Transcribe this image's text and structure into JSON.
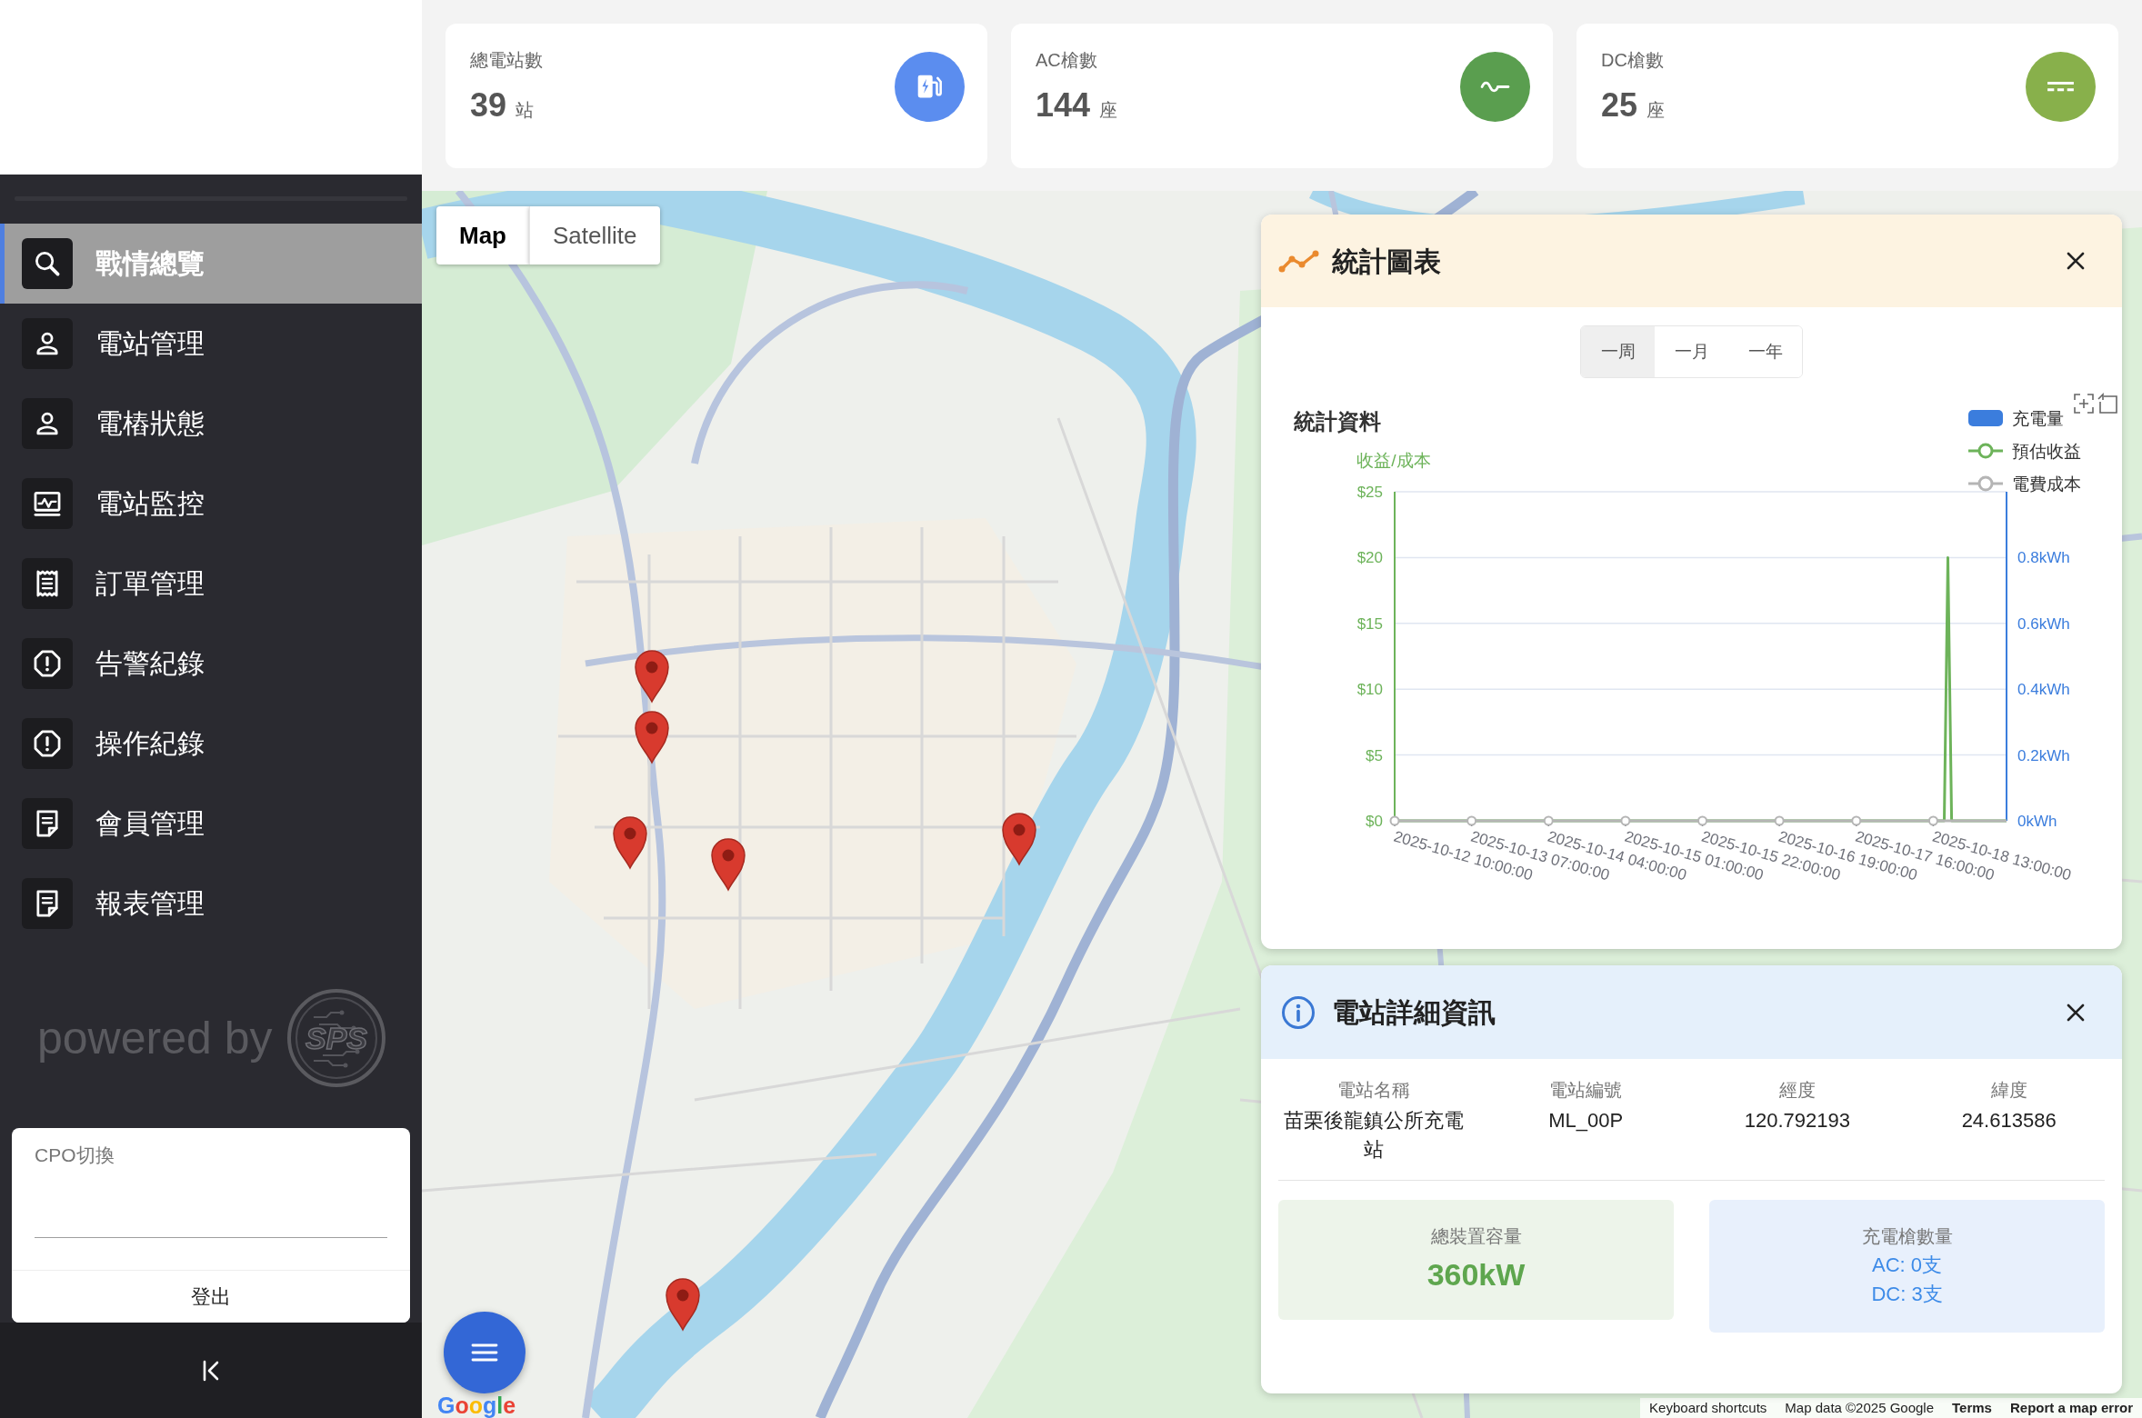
{
  "sidebar": {
    "menu": [
      {
        "label": "戰情總覽",
        "kind": "search",
        "selected": true
      },
      {
        "label": "電站管理",
        "kind": "person",
        "selected": false
      },
      {
        "label": "電樁狀態",
        "kind": "person",
        "selected": false
      },
      {
        "label": "電站監控",
        "kind": "monitor",
        "selected": false
      },
      {
        "label": "訂單管理",
        "kind": "receipt",
        "selected": false
      },
      {
        "label": "告警紀錄",
        "kind": "alert",
        "selected": false
      },
      {
        "label": "操作紀錄",
        "kind": "alert",
        "selected": false
      },
      {
        "label": "會員管理",
        "kind": "document",
        "selected": false
      },
      {
        "label": "報表管理",
        "kind": "document",
        "selected": false
      }
    ],
    "powered_by": {
      "text": "powered by",
      "logo_text": "SPS"
    },
    "cpo_select": {
      "label": "CPO切換"
    },
    "logout": "登出"
  },
  "stats": [
    {
      "label": "總電站數",
      "value": "39",
      "unit": "站",
      "kind": "station",
      "color": "#5b8def"
    },
    {
      "label": "AC槍數",
      "value": "144",
      "unit": "座",
      "kind": "ac",
      "color": "#5a9e4f"
    },
    {
      "label": "DC槍數",
      "value": "25",
      "unit": "座",
      "kind": "dc",
      "color": "#88b04b"
    }
  ],
  "map": {
    "map_type": [
      {
        "label": "Map",
        "selected": true
      },
      {
        "label": "Satellite",
        "selected": false
      }
    ],
    "logo": "Google",
    "attribution": [
      {
        "text": "Keyboard shortcuts",
        "kind": "button"
      },
      {
        "text": "Map data ©2025 Google",
        "kind": "text"
      },
      {
        "text": "Terms",
        "kind": "link"
      },
      {
        "text": "Report a map error",
        "kind": "link"
      }
    ]
  },
  "chart_panel": {
    "title": "統計圖表",
    "range_tabs": [
      {
        "label": "一周",
        "selected": true
      },
      {
        "label": "一月",
        "selected": false
      },
      {
        "label": "一年",
        "selected": false
      }
    ],
    "chart_data": {
      "type": "line",
      "title": "統計資料",
      "ylabel": "收益/成本",
      "grid": true,
      "legend": "upper right",
      "categories": [
        "2025-10-12 10:00:00",
        null,
        null,
        null,
        null,
        null,
        null,
        null,
        null,
        null,
        null,
        null,
        null,
        null,
        null,
        null,
        null,
        null,
        null,
        null,
        null,
        "2025-10-13 07:00:00",
        null,
        null,
        null,
        null,
        null,
        null,
        null,
        null,
        null,
        null,
        null,
        null,
        null,
        null,
        null,
        null,
        null,
        null,
        null,
        null,
        "2025-10-14 04:00:00",
        null,
        null,
        null,
        null,
        null,
        null,
        null,
        null,
        null,
        null,
        null,
        null,
        null,
        null,
        null,
        null,
        null,
        null,
        null,
        null,
        "2025-10-15 01:00:00",
        null,
        null,
        null,
        null,
        null,
        null,
        null,
        null,
        null,
        null,
        null,
        null,
        null,
        null,
        null,
        null,
        null,
        null,
        null,
        null,
        "2025-10-15 22:00:00",
        null,
        null,
        null,
        null,
        null,
        null,
        null,
        null,
        null,
        null,
        null,
        null,
        null,
        null,
        null,
        null,
        null,
        null,
        null,
        null,
        "2025-10-16 19:00:00",
        null,
        null,
        null,
        null,
        null,
        null,
        null,
        null,
        null,
        null,
        null,
        null,
        null,
        null,
        null,
        null,
        null,
        null,
        null,
        null,
        "2025-10-17 16:00:00",
        null,
        null,
        null,
        null,
        null,
        null,
        null,
        null,
        null,
        null,
        null,
        null,
        null,
        null,
        null,
        null,
        null,
        null,
        null,
        null,
        "2025-10-18 13:00:00",
        null,
        null,
        null,
        null,
        null,
        null,
        null,
        null,
        null,
        null,
        null,
        null,
        null,
        null,
        null,
        null,
        null,
        null,
        null,
        null
      ],
      "ylim": [
        0,
        25
      ],
      "yticks": [
        {
          "value": 0,
          "label": "$0"
        },
        {
          "value": 5,
          "label": "$5"
        },
        {
          "value": 10,
          "label": "$10"
        },
        {
          "value": 15,
          "label": "$15"
        },
        {
          "value": 20,
          "label": "$20"
        },
        {
          "value": 25,
          "label": "$25"
        }
      ],
      "y2lim": [
        0,
        1
      ],
      "y2ticks": [
        {
          "value": 0,
          "label": "0kWh"
        },
        {
          "value": 0.2,
          "label": "0.2kWh"
        },
        {
          "value": 0.4,
          "label": "0.4kWh"
        },
        {
          "value": 0.6,
          "label": "0.6kWh"
        },
        {
          "value": 0.8,
          "label": "0.8kWh"
        }
      ],
      "series": [
        {
          "name": "充電量",
          "type": "bar",
          "axis": "y2",
          "color": "#3b7ddd",
          "values": [
            0,
            0,
            0,
            0,
            0,
            0,
            0,
            0,
            0,
            0,
            0,
            0,
            0,
            0,
            0,
            0,
            0,
            0,
            0,
            0,
            0,
            0,
            0,
            0,
            0,
            0,
            0,
            0,
            0,
            0,
            0,
            0,
            0,
            0,
            0,
            0,
            0,
            0,
            0,
            0,
            0,
            0,
            0,
            0,
            0,
            0,
            0,
            0,
            0,
            0,
            0,
            0,
            0,
            0,
            0,
            0,
            0,
            0,
            0,
            0,
            0,
            0,
            0,
            0,
            0,
            0,
            0,
            0,
            0,
            0,
            0,
            0,
            0,
            0,
            0,
            0,
            0,
            0,
            0,
            0,
            0,
            0,
            0,
            0,
            0,
            0,
            0,
            0,
            0,
            0,
            0,
            0,
            0,
            0,
            0,
            0,
            0,
            0,
            0,
            0,
            0,
            0,
            0,
            0,
            0,
            0,
            0,
            0,
            0,
            0,
            0,
            0,
            0,
            0,
            0,
            0,
            0,
            0,
            0,
            0,
            0,
            0,
            0,
            0,
            0,
            0,
            0,
            0,
            0,
            0,
            0,
            0,
            0,
            0,
            0,
            0,
            0,
            0,
            0,
            0,
            0,
            0,
            0,
            0,
            0,
            0,
            0,
            0,
            0,
            0,
            0,
            0,
            0,
            0,
            0,
            0,
            0,
            0,
            0,
            0,
            0,
            0,
            0,
            0,
            0,
            0,
            0,
            0
          ]
        },
        {
          "name": "預估收益",
          "type": "line",
          "color": "#6db35a",
          "values": [
            0,
            0,
            0,
            0,
            0,
            0,
            0,
            0,
            0,
            0,
            0,
            0,
            0,
            0,
            0,
            0,
            0,
            0,
            0,
            0,
            0,
            0,
            0,
            0,
            0,
            0,
            0,
            0,
            0,
            0,
            0,
            0,
            0,
            0,
            0,
            0,
            0,
            0,
            0,
            0,
            0,
            0,
            0,
            0,
            0,
            0,
            0,
            0,
            0,
            0,
            0,
            0,
            0,
            0,
            0,
            0,
            0,
            0,
            0,
            0,
            0,
            0,
            0,
            0,
            0,
            0,
            0,
            0,
            0,
            0,
            0,
            0,
            0,
            0,
            0,
            0,
            0,
            0,
            0,
            0,
            0,
            0,
            0,
            0,
            0,
            0,
            0,
            0,
            0,
            0,
            0,
            0,
            0,
            0,
            0,
            0,
            0,
            0,
            0,
            0,
            0,
            0,
            0,
            0,
            0,
            0,
            0,
            0,
            0,
            0,
            0,
            0,
            0,
            0,
            0,
            0,
            0,
            0,
            0,
            0,
            0,
            0,
            0,
            0,
            0,
            0,
            0,
            0,
            0,
            0,
            0,
            0,
            0,
            0,
            0,
            0,
            0,
            0,
            0,
            0,
            0,
            0,
            0,
            0,
            0,
            0,
            0,
            0,
            0,
            0,
            0,
            20,
            0,
            0,
            0,
            0,
            0,
            0,
            0,
            0,
            0,
            0,
            0,
            0,
            0,
            0,
            0,
            0
          ]
        },
        {
          "name": "電費成本",
          "type": "line",
          "color": "#b5b5b5",
          "values": [
            0,
            0,
            0,
            0,
            0,
            0,
            0,
            0,
            0,
            0,
            0,
            0,
            0,
            0,
            0,
            0,
            0,
            0,
            0,
            0,
            0,
            0,
            0,
            0,
            0,
            0,
            0,
            0,
            0,
            0,
            0,
            0,
            0,
            0,
            0,
            0,
            0,
            0,
            0,
            0,
            0,
            0,
            0,
            0,
            0,
            0,
            0,
            0,
            0,
            0,
            0,
            0,
            0,
            0,
            0,
            0,
            0,
            0,
            0,
            0,
            0,
            0,
            0,
            0,
            0,
            0,
            0,
            0,
            0,
            0,
            0,
            0,
            0,
            0,
            0,
            0,
            0,
            0,
            0,
            0,
            0,
            0,
            0,
            0,
            0,
            0,
            0,
            0,
            0,
            0,
            0,
            0,
            0,
            0,
            0,
            0,
            0,
            0,
            0,
            0,
            0,
            0,
            0,
            0,
            0,
            0,
            0,
            0,
            0,
            0,
            0,
            0,
            0,
            0,
            0,
            0,
            0,
            0,
            0,
            0,
            0,
            0,
            0,
            0,
            0,
            0,
            0,
            0,
            0,
            0,
            0,
            0,
            0,
            0,
            0,
            0,
            0,
            0,
            0,
            0,
            0,
            0,
            0,
            0,
            0,
            0,
            0,
            0,
            0,
            0,
            0,
            0,
            0,
            0,
            0,
            0,
            0,
            0,
            0,
            0,
            0,
            0,
            0,
            0,
            0,
            0,
            0,
            0
          ]
        }
      ]
    }
  },
  "station_panel": {
    "title": "電站詳細資訊",
    "fields": [
      {
        "label": "電站名稱",
        "value": "苗栗後龍鎮公所充電站"
      },
      {
        "label": "電站編號",
        "value": "ML_00P"
      },
      {
        "label": "經度",
        "value": "120.792193"
      },
      {
        "label": "緯度",
        "value": "24.613586"
      }
    ],
    "capacity": {
      "label": "總裝置容量",
      "value": "360kW"
    },
    "guns": {
      "label": "充電槍數量",
      "lines": [
        "AC: 0支",
        "DC: 3支"
      ]
    }
  }
}
